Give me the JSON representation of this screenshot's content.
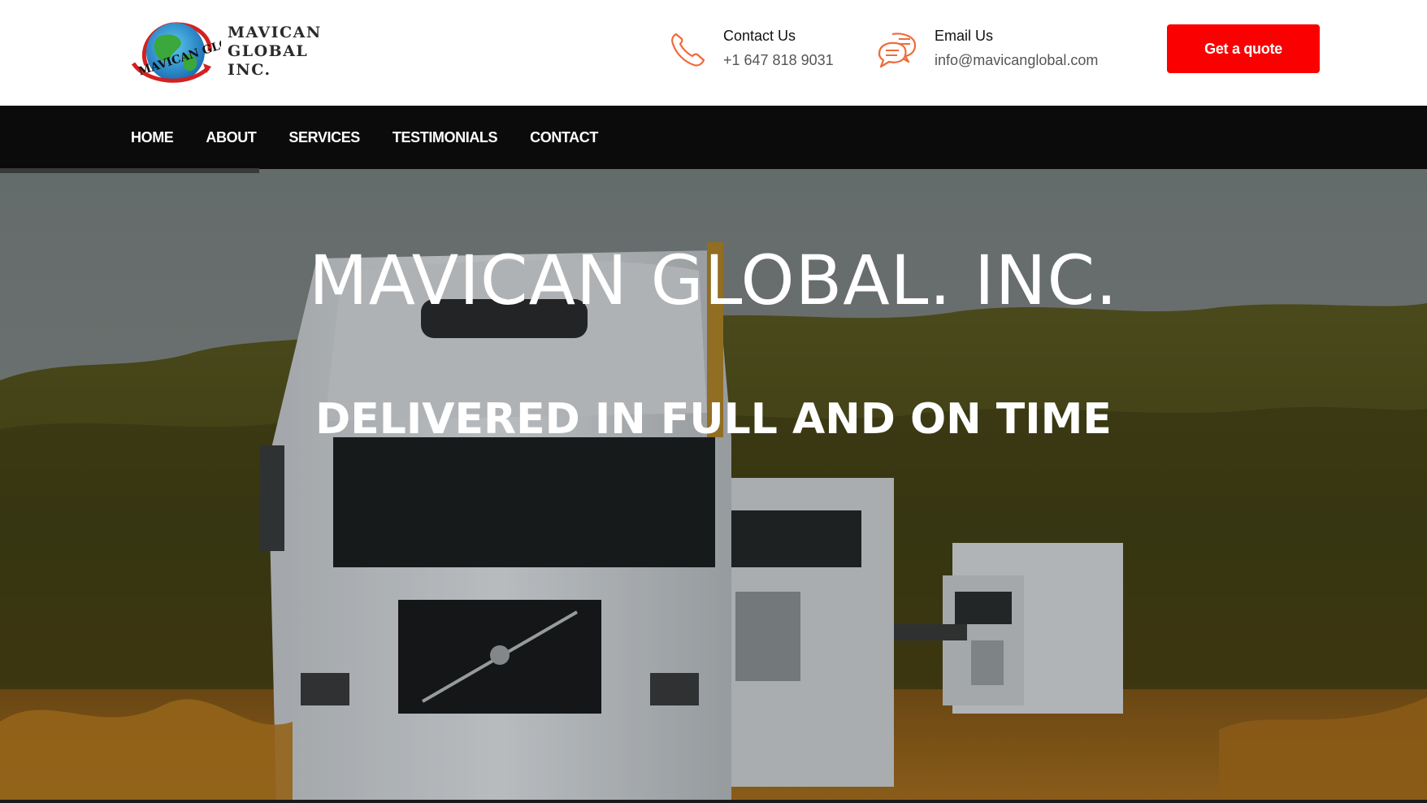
{
  "header": {
    "logo": {
      "line1": "MAVICAN GLOBAL",
      "line2": "INC.",
      "mark_text": "MAVICAN GLOBAL",
      "mark_icon": "globe-logo-icon"
    },
    "phone": {
      "icon": "phone-icon",
      "title": "Contact Us",
      "value": "+1 647 818 9031"
    },
    "email": {
      "icon": "chat-bubbles-icon",
      "title": "Email Us",
      "value": "info@mavicanglobal.com"
    },
    "quote_button": "Get a quote"
  },
  "nav": {
    "items": [
      {
        "label": "HOME"
      },
      {
        "label": "ABOUT"
      },
      {
        "label": "SERVICES"
      },
      {
        "label": "TESTIMONIALS"
      },
      {
        "label": "CONTACT"
      }
    ]
  },
  "hero": {
    "title": "MAVICAN GLOBAL. INC.",
    "subtitle": "DELIVERED IN FULL AND ON TIME"
  },
  "colors": {
    "accent": "#fb0000",
    "nav_bg": "#0b0b0b",
    "icon_orange": "#f06a3a"
  }
}
